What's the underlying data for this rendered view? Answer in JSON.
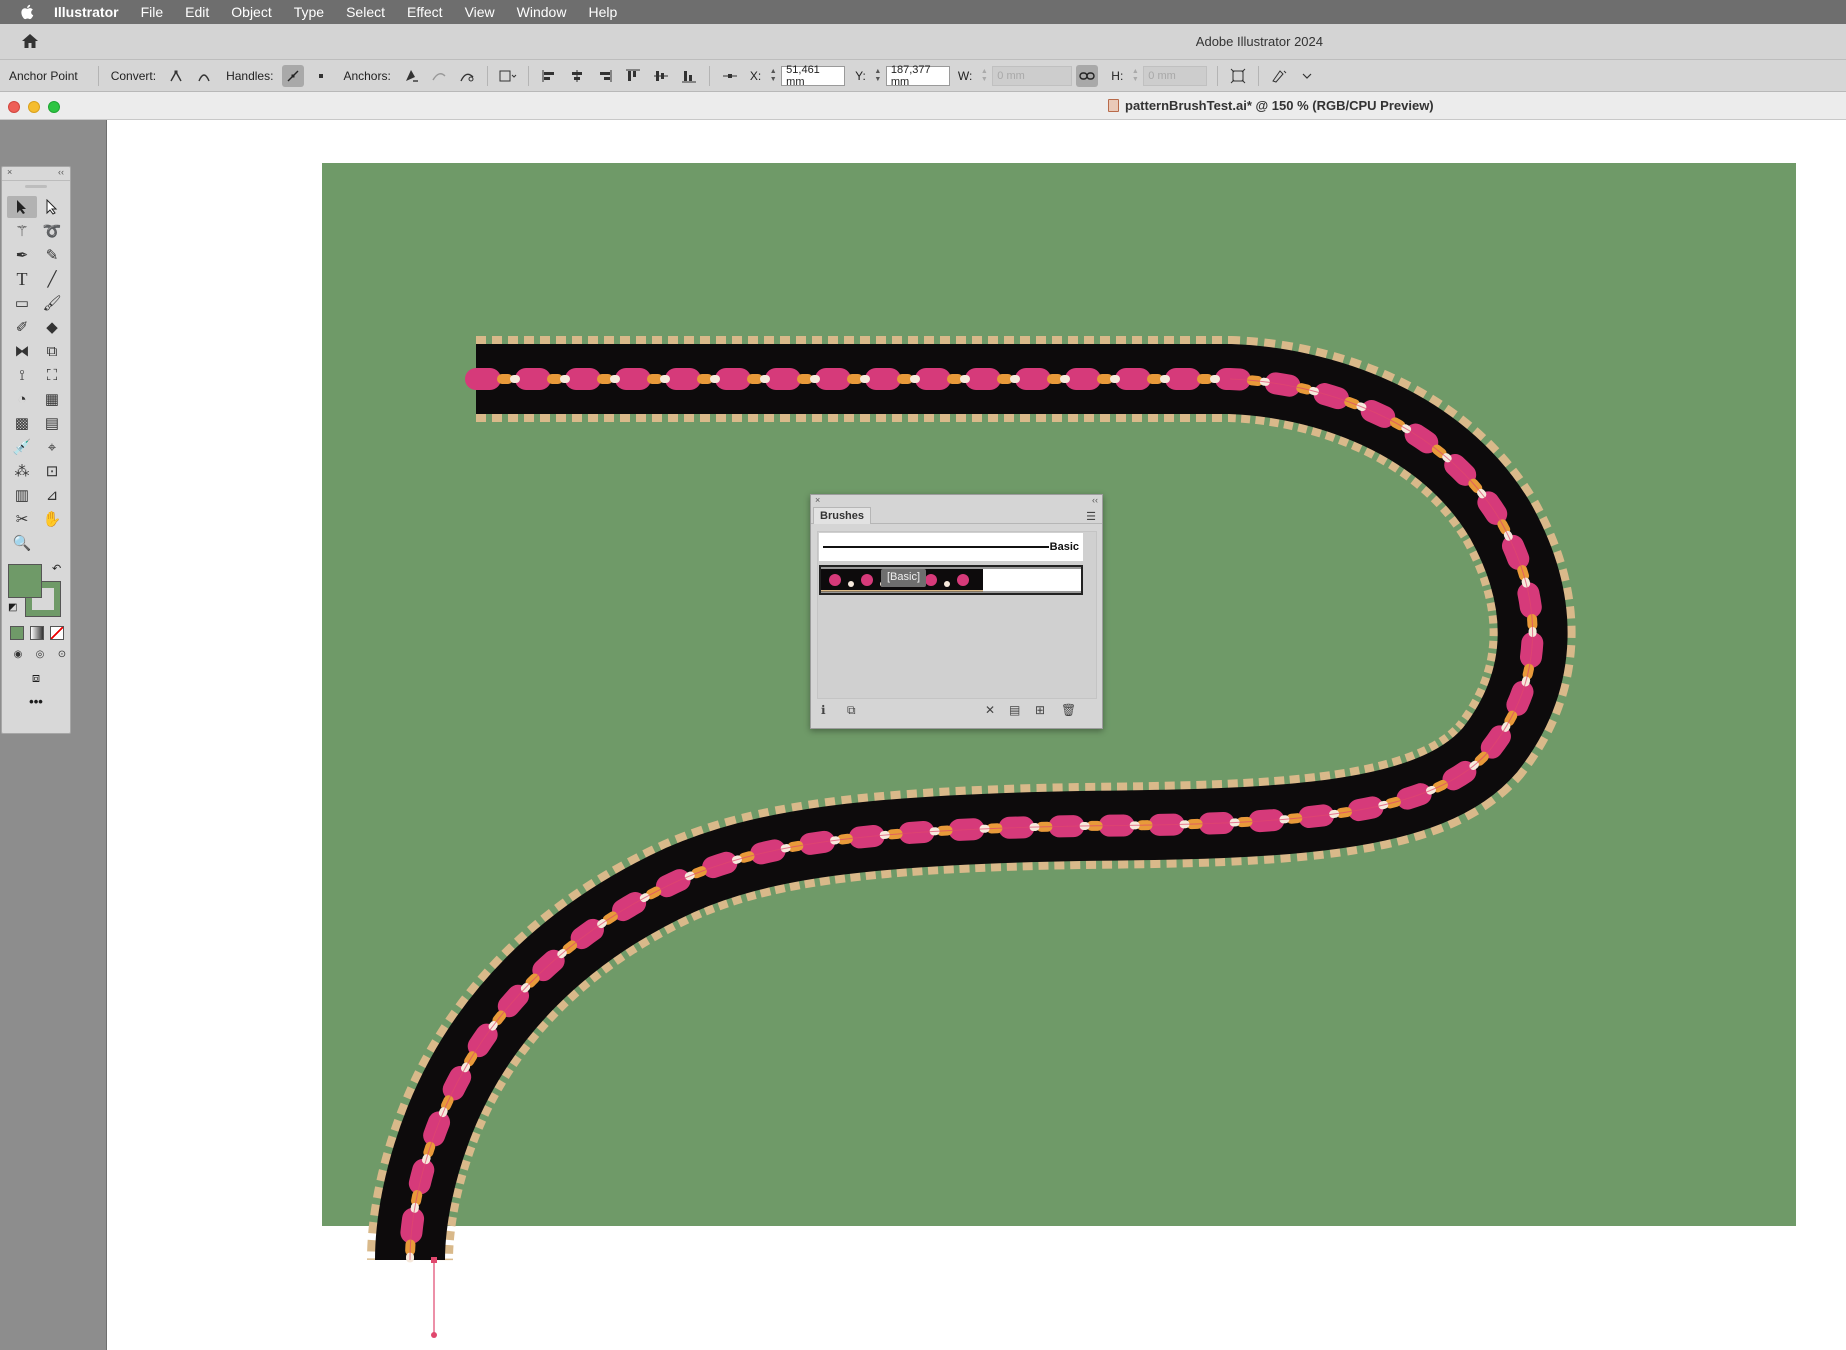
{
  "menubar": {
    "app_name": "Illustrator",
    "items": [
      "File",
      "Edit",
      "Object",
      "Type",
      "Select",
      "Effect",
      "View",
      "Window",
      "Help"
    ]
  },
  "app_window": {
    "title": "Adobe Illustrator 2024"
  },
  "control_bar": {
    "selection_label": "Anchor Point",
    "convert_label": "Convert:",
    "handles_label": "Handles:",
    "anchors_label": "Anchors:",
    "x_label": "X:",
    "x_value": "51,461 mm",
    "y_label": "Y:",
    "y_value": "187,377 mm",
    "w_label": "W:",
    "w_value": "0 mm",
    "h_label": "H:",
    "h_value": "0 mm"
  },
  "document": {
    "title": "patternBrushTest.ai* @ 150 % (RGB/CPU Preview)"
  },
  "brushes_panel": {
    "tab_label": "Brushes",
    "basic_brush_name": "Basic",
    "tooltip": "[Basic]"
  },
  "colors": {
    "artboard": "#6f9a68",
    "pattern_band": "#0d0b0c",
    "pattern_accent": "#d63a7a",
    "pattern_gold": "#d9b98a",
    "anchor": "#e0476d"
  }
}
